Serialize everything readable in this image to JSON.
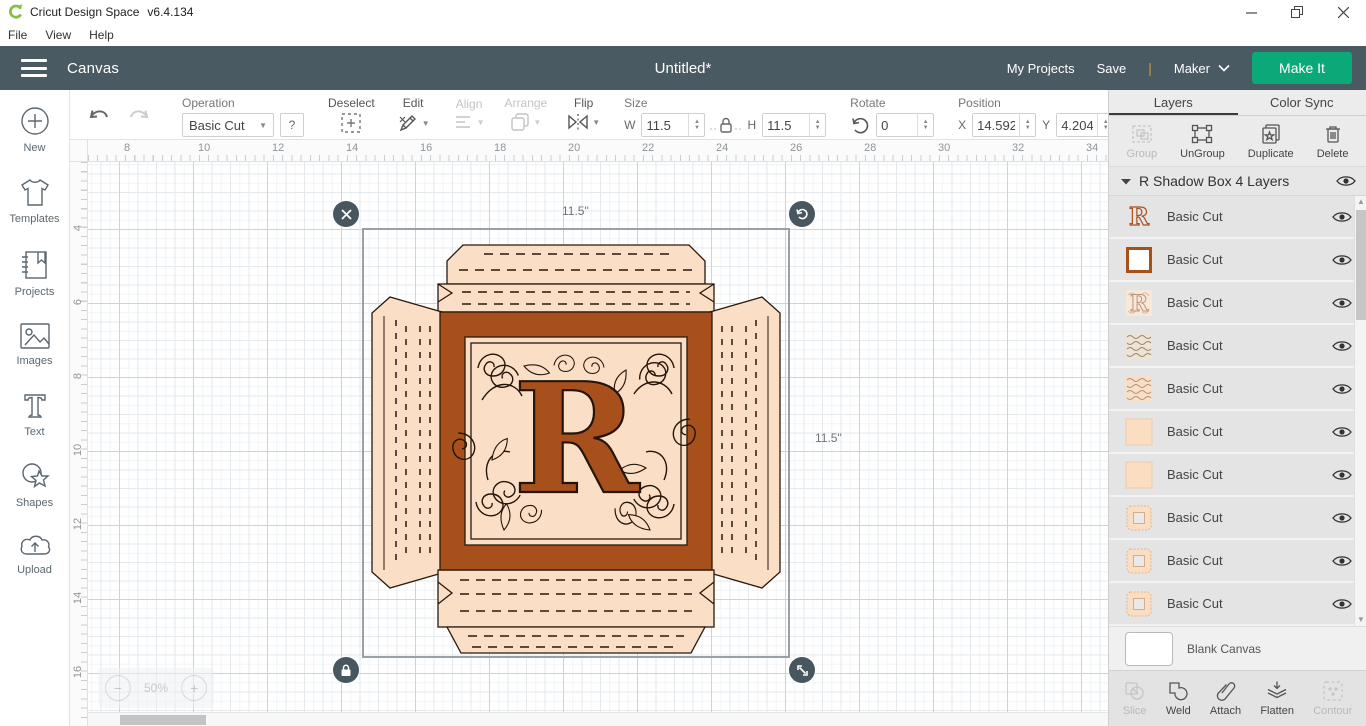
{
  "titlebar": {
    "app_name": "Cricut Design Space",
    "version": "v6.4.134"
  },
  "window_controls": {
    "minimize": "–",
    "restore": "❐",
    "close": "✕"
  },
  "menubar": {
    "items": [
      {
        "label": "File"
      },
      {
        "label": "View"
      },
      {
        "label": "Help"
      }
    ]
  },
  "header": {
    "nav": "Canvas",
    "doc_title": "Untitled*",
    "my_projects": "My Projects",
    "save": "Save",
    "divider": "|",
    "machine": "Maker",
    "make_it": "Make It"
  },
  "toolbar": {
    "operation": {
      "label": "Operation",
      "value": "Basic Cut",
      "help": "?"
    },
    "deselect_label": "Deselect",
    "edit_label": "Edit",
    "align_label": "Align",
    "arrange_label": "Arrange",
    "flip_label": "Flip",
    "size": {
      "label": "Size",
      "w_label": "W",
      "w_value": "11.5",
      "h_label": "H",
      "h_value": "11.5"
    },
    "rotate": {
      "label": "Rotate",
      "value": "0"
    },
    "position": {
      "label": "Position",
      "x_label": "X",
      "x_value": "14.592",
      "y_label": "Y",
      "y_value": "4.204"
    }
  },
  "sidebar": {
    "items": [
      {
        "label": "New",
        "icon": "plus-circle-icon"
      },
      {
        "label": "Templates",
        "icon": "shirt-icon"
      },
      {
        "label": "Projects",
        "icon": "notebook-icon"
      },
      {
        "label": "Images",
        "icon": "image-icon"
      },
      {
        "label": "Text",
        "icon": "text-icon"
      },
      {
        "label": "Shapes",
        "icon": "shapes-icon"
      },
      {
        "label": "Upload",
        "icon": "cloud-upload-icon"
      }
    ]
  },
  "canvas": {
    "ruler_top": [
      "8",
      "10",
      "12",
      "14",
      "16",
      "18",
      "20",
      "22",
      "24",
      "26",
      "28",
      "30",
      "32",
      "34"
    ],
    "ruler_left": [
      "4",
      "6",
      "8",
      "10",
      "12",
      "14",
      "16"
    ],
    "zoom_level": "50%",
    "zoom_out": "−",
    "zoom_in": "+",
    "selection": {
      "width_label": "11.5\"",
      "height_label": "11.5\""
    }
  },
  "layers_panel": {
    "tabs": [
      {
        "label": "Layers"
      },
      {
        "label": "Color Sync"
      }
    ],
    "actions": [
      {
        "label": "Group",
        "disabled": true
      },
      {
        "label": "UnGroup",
        "disabled": false
      },
      {
        "label": "Duplicate",
        "disabled": false
      },
      {
        "label": "Delete",
        "disabled": false
      }
    ],
    "group_title": "R Shadow Box 4 Layers",
    "layers": [
      {
        "label": "Basic Cut",
        "thumb": "ornate-letter-r"
      },
      {
        "label": "Basic Cut",
        "thumb": "square-frame"
      },
      {
        "label": "Basic Cut",
        "thumb": "letter-pattern-light"
      },
      {
        "label": "Basic Cut",
        "thumb": "pattern-dense-gray"
      },
      {
        "label": "Basic Cut",
        "thumb": "pattern-dense-tan"
      },
      {
        "label": "Basic Cut",
        "thumb": "peach-square"
      },
      {
        "label": "Basic Cut",
        "thumb": "peach-square"
      },
      {
        "label": "Basic Cut",
        "thumb": "box-frame"
      },
      {
        "label": "Basic Cut",
        "thumb": "box-frame"
      },
      {
        "label": "Basic Cut",
        "thumb": "box-frame"
      }
    ],
    "blank_canvas_label": "Blank Canvas",
    "bottom_actions": [
      {
        "label": "Slice",
        "disabled": true
      },
      {
        "label": "Weld",
        "disabled": false
      },
      {
        "label": "Attach",
        "disabled": false
      },
      {
        "label": "Flatten",
        "disabled": false
      },
      {
        "label": "Contour",
        "disabled": true
      }
    ]
  },
  "colors": {
    "header_bg": "#4a5a63",
    "accent_green": "#0ba878",
    "logo_green": "#84bf41",
    "design_brown": "#a8501c",
    "design_peach": "#fadfc6",
    "gold_divider": "#c19a3f"
  }
}
